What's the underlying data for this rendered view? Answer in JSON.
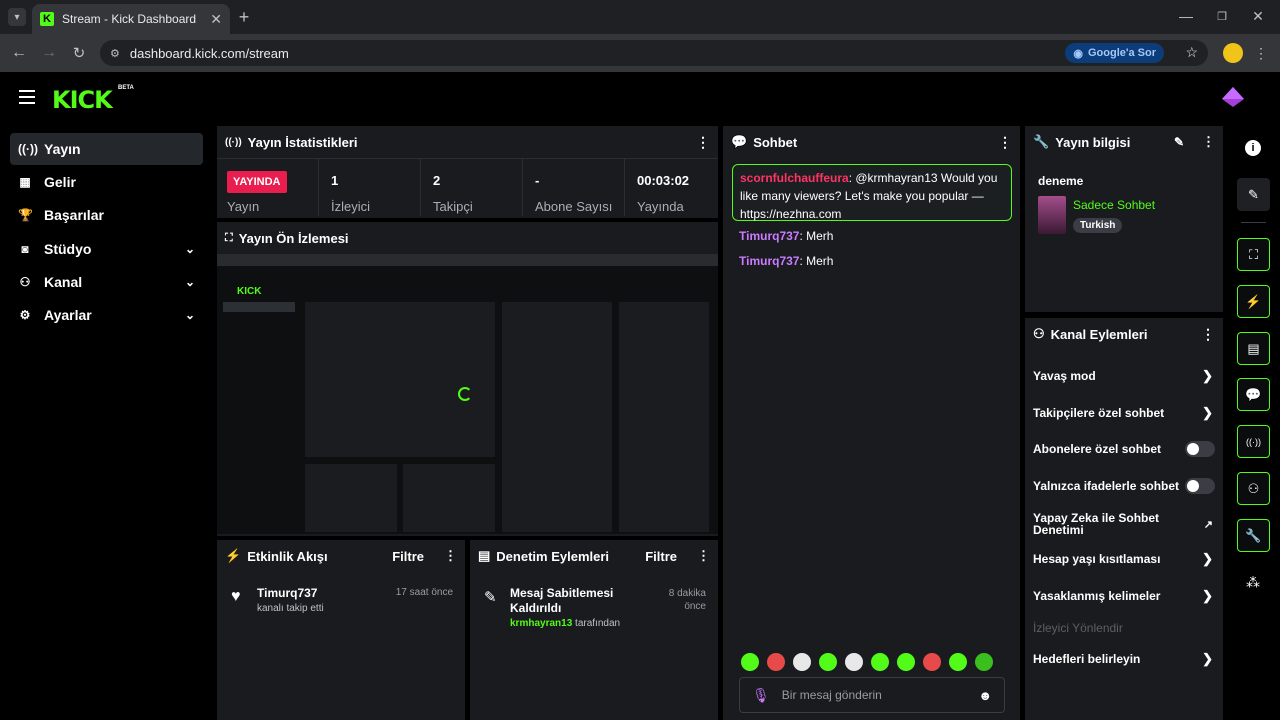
{
  "browser": {
    "tab_title": "Stream - Kick Dashboard",
    "url": "dashboard.kick.com/stream",
    "google_button": "Google'a Sor"
  },
  "app": {
    "logo": "KICK",
    "beta": "BETA"
  },
  "sidebar": {
    "items": [
      {
        "label": "Yayın",
        "icon": "broadcast-icon"
      },
      {
        "label": "Gelir",
        "icon": "revenue-icon"
      },
      {
        "label": "Başarılar",
        "icon": "trophy-icon"
      },
      {
        "label": "Stüdyo",
        "icon": "studio-icon"
      },
      {
        "label": "Kanal",
        "icon": "channel-icon"
      },
      {
        "label": "Ayarlar",
        "icon": "gear-icon"
      }
    ]
  },
  "stats": {
    "title": "Yayın İstatistikleri",
    "live_badge": "YAYINDA",
    "live_label": "Yayın",
    "viewers_value": "1",
    "viewers_label": "İzleyici",
    "followers_value": "2",
    "followers_label": "Takipçi",
    "subs_value": "-",
    "subs_label": "Abone Sayısı",
    "uptime_value": "00:03:02",
    "uptime_label": "Yayında"
  },
  "preview": {
    "title": "Yayın Ön İzlemesi"
  },
  "activity": {
    "title": "Etkinlik Akışı",
    "filter": "Filtre",
    "item_user": "Timurq737",
    "item_text": "kanalı takip etti",
    "item_time": "17 saat önce"
  },
  "moderation": {
    "title": "Denetim Eylemleri",
    "filter": "Filtre",
    "item_title": "Mesaj Sabitlemesi Kaldırıldı",
    "item_by_user": "krmhayran13",
    "item_by_text": "tarafından",
    "item_time": "8 dakika önce"
  },
  "chat": {
    "title": "Sohbet",
    "pinned_user": "scornfulchauffeura",
    "pinned_text": "@krmhayran13 Would you like many viewers? Let's make you popular — https://nezhna.com",
    "messages": [
      {
        "user": "Timurq737",
        "text": "Merh"
      },
      {
        "user": "Timurq737",
        "text": "Merh"
      }
    ],
    "input_placeholder": "Bir mesaj gönderin"
  },
  "stream_info": {
    "title": "Yayın bilgisi",
    "stream_title": "deneme",
    "category": "Sadece Sohbet",
    "language": "Turkish"
  },
  "channel_actions": {
    "title": "Kanal Eylemleri",
    "items": [
      "Yavaş mod",
      "Takipçilere özel sohbet",
      "Abonelere özel sohbet",
      "Yalnızca ifadelerle sohbet",
      "Yapay Zeka ile Sohbet Denetimi",
      "Hesap yaşı kısıtlaması",
      "Yasaklanmış kelimeler",
      "İzleyici Yönlendir",
      "Hedefleri belirleyin"
    ]
  },
  "colors": {
    "brand": "#53fc18",
    "live": "#e91e4f",
    "chat_user": "#c97cff",
    "panel": "#191b1f"
  }
}
